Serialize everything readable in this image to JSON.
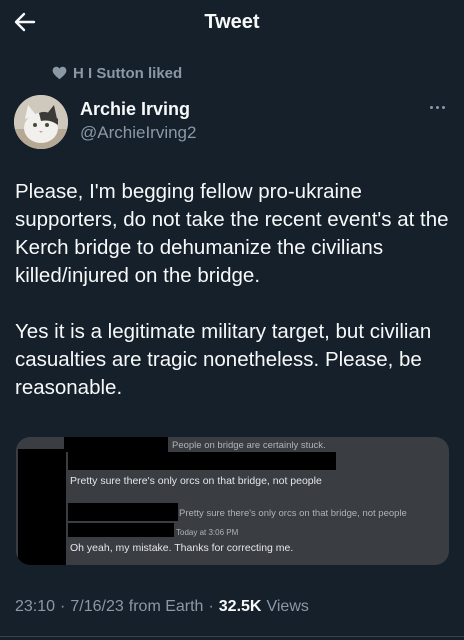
{
  "topbar": {
    "title": "Tweet"
  },
  "social_context": {
    "text": "H I Sutton liked"
  },
  "author": {
    "name": "Archie Irving",
    "handle": "@ArchieIrving2"
  },
  "tweet": {
    "paragraphs": [
      "Please, I'm begging fellow pro-ukraine supporters, do not take the recent event's at the Kerch bridge to dehumanize the civilians killed/injured on the bridge.",
      "Yes it is a legitimate military target, but civilian casualties are tragic nonetheless. Please, be reasonable."
    ]
  },
  "media": {
    "line1": "People on bridge are certainly stuck.",
    "line2": "Pretty sure there's only orcs on that bridge, not people",
    "line3": "Pretty sure there's only orcs on that bridge, not people",
    "time": "Today at 3:06 PM",
    "line4": "Oh yeah, my mistake. Thanks for correcting me."
  },
  "meta": {
    "time": "23:10",
    "date": "7/16/23",
    "source": "from Earth",
    "views_count": "32.5K",
    "views_label": "Views"
  },
  "colors": {
    "background": "#15202b",
    "primary_text": "#f7f9f9",
    "secondary_text": "#8b98a5"
  }
}
